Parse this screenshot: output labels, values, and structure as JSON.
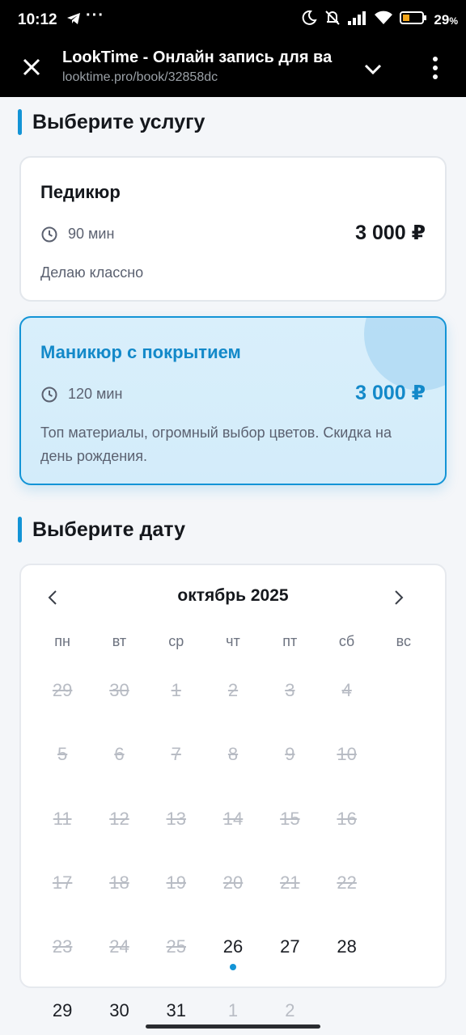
{
  "status_bar": {
    "time": "10:12",
    "battery": "29",
    "battery_unit": "%",
    "icons": [
      "telegram-icon",
      "more-notifications-icon",
      "moon-icon",
      "mute-icon",
      "signal-icon",
      "wifi-icon",
      "battery-icon"
    ]
  },
  "browser": {
    "title": "LookTime - Онлайн запись для ва",
    "url": "looktime.pro/book/32858dc",
    "icons": [
      "close-icon",
      "chevron-down-icon",
      "more-vert-icon"
    ]
  },
  "services_section": {
    "title": "Выберите услугу"
  },
  "services": [
    {
      "name": "Педикюр",
      "duration": "90 мин",
      "price": "3 000 ₽",
      "description": "Делаю классно",
      "selected": false
    },
    {
      "name": "Маникюр с покрытием",
      "duration": "120 мин",
      "price": "3 000 ₽",
      "description": "Топ материалы, огромный выбор цветов. Скидка на день рождения.",
      "selected": true
    }
  ],
  "date_section": {
    "title": "Выберите дату"
  },
  "calendar": {
    "month_label": "октябрь 2025",
    "weekdays": [
      "пн",
      "вт",
      "ср",
      "чт",
      "пт",
      "сб",
      "вс"
    ],
    "days": [
      {
        "label": "29",
        "state": "disabled"
      },
      {
        "label": "30",
        "state": "disabled"
      },
      {
        "label": "1",
        "state": "disabled"
      },
      {
        "label": "2",
        "state": "disabled"
      },
      {
        "label": "3",
        "state": "disabled"
      },
      {
        "label": "4",
        "state": "disabled"
      },
      {
        "label": "5",
        "state": "disabled"
      },
      {
        "label": "6",
        "state": "disabled"
      },
      {
        "label": "7",
        "state": "disabled"
      },
      {
        "label": "8",
        "state": "disabled"
      },
      {
        "label": "9",
        "state": "disabled"
      },
      {
        "label": "10",
        "state": "disabled"
      },
      {
        "label": "11",
        "state": "disabled"
      },
      {
        "label": "12",
        "state": "disabled"
      },
      {
        "label": "13",
        "state": "disabled"
      },
      {
        "label": "14",
        "state": "disabled"
      },
      {
        "label": "15",
        "state": "disabled"
      },
      {
        "label": "16",
        "state": "disabled"
      },
      {
        "label": "17",
        "state": "disabled"
      },
      {
        "label": "18",
        "state": "disabled"
      },
      {
        "label": "19",
        "state": "disabled"
      },
      {
        "label": "20",
        "state": "disabled"
      },
      {
        "label": "21",
        "state": "disabled"
      },
      {
        "label": "22",
        "state": "disabled"
      },
      {
        "label": "23",
        "state": "disabled"
      },
      {
        "label": "24",
        "state": "disabled"
      },
      {
        "label": "25",
        "state": "disabled"
      },
      {
        "label": "26",
        "state": "today"
      },
      {
        "label": "27",
        "state": "available"
      },
      {
        "label": "28",
        "state": "available"
      },
      {
        "label": "29",
        "state": "available"
      },
      {
        "label": "30",
        "state": "available"
      },
      {
        "label": "31",
        "state": "available"
      },
      {
        "label": "1",
        "state": "other-month"
      },
      {
        "label": "2",
        "state": "other-month"
      }
    ]
  },
  "colors": {
    "accent": "#1394d6",
    "selected_card_bg": "#d9effb",
    "disabled_text": "#b8bcc4"
  }
}
